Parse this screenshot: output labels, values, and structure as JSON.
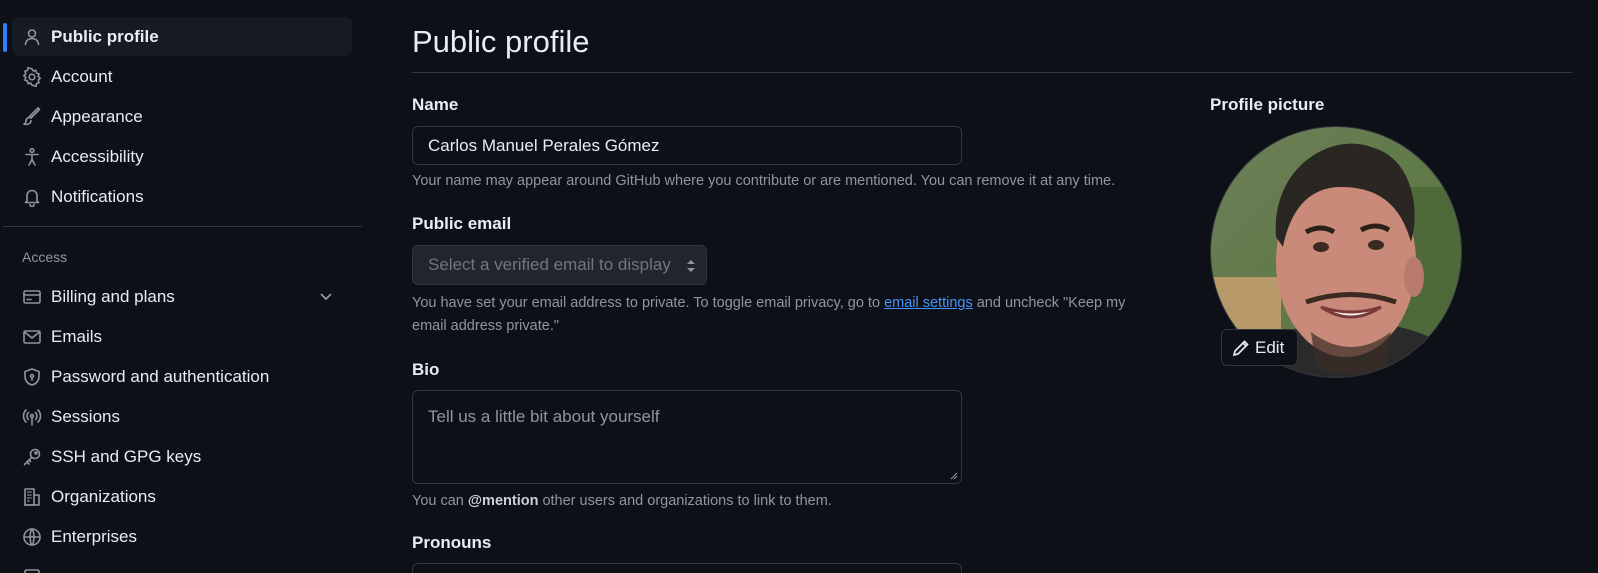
{
  "sidebar": {
    "items_top": [
      {
        "label": "Public profile",
        "icon": "person-icon",
        "active": true
      },
      {
        "label": "Account",
        "icon": "gear-icon"
      },
      {
        "label": "Appearance",
        "icon": "paintbrush-icon"
      },
      {
        "label": "Accessibility",
        "icon": "accessibility-icon"
      },
      {
        "label": "Notifications",
        "icon": "bell-icon"
      }
    ],
    "access_heading": "Access",
    "items_access": [
      {
        "label": "Billing and plans",
        "icon": "credit-card-icon"
      },
      {
        "label": "Emails",
        "icon": "mail-icon"
      },
      {
        "label": "Password and authentication",
        "icon": "shield-lock-icon"
      },
      {
        "label": "Sessions",
        "icon": "broadcast-icon"
      },
      {
        "label": "SSH and GPG keys",
        "icon": "key-icon"
      },
      {
        "label": "Organizations",
        "icon": "organization-icon"
      },
      {
        "label": "Enterprises",
        "icon": "globe-icon"
      }
    ]
  },
  "main": {
    "title": "Public profile",
    "name": {
      "label": "Name",
      "value": "Carlos Manuel Perales Gómez",
      "note": "Your name may appear around GitHub where you contribute or are mentioned. You can remove it at any time."
    },
    "email": {
      "label": "Public email",
      "placeholder": "Select a verified email to display",
      "note_before": "You have set your email address to private. To toggle email privacy, go to ",
      "note_link": "email settings",
      "note_after": " and uncheck \"Keep my email address private.\""
    },
    "bio": {
      "label": "Bio",
      "placeholder": "Tell us a little bit about yourself",
      "note_before": "You can ",
      "note_mention": "@mention",
      "note_after": " other users and organizations to link to them."
    },
    "pronouns": {
      "label": "Pronouns"
    }
  },
  "profile_picture": {
    "label": "Profile picture",
    "edit_label": "Edit"
  },
  "colors": {
    "background": "#0d1117",
    "accent": "#2f81f7",
    "link": "#4493f8",
    "border": "#30363d",
    "muted": "#8d96a0"
  }
}
